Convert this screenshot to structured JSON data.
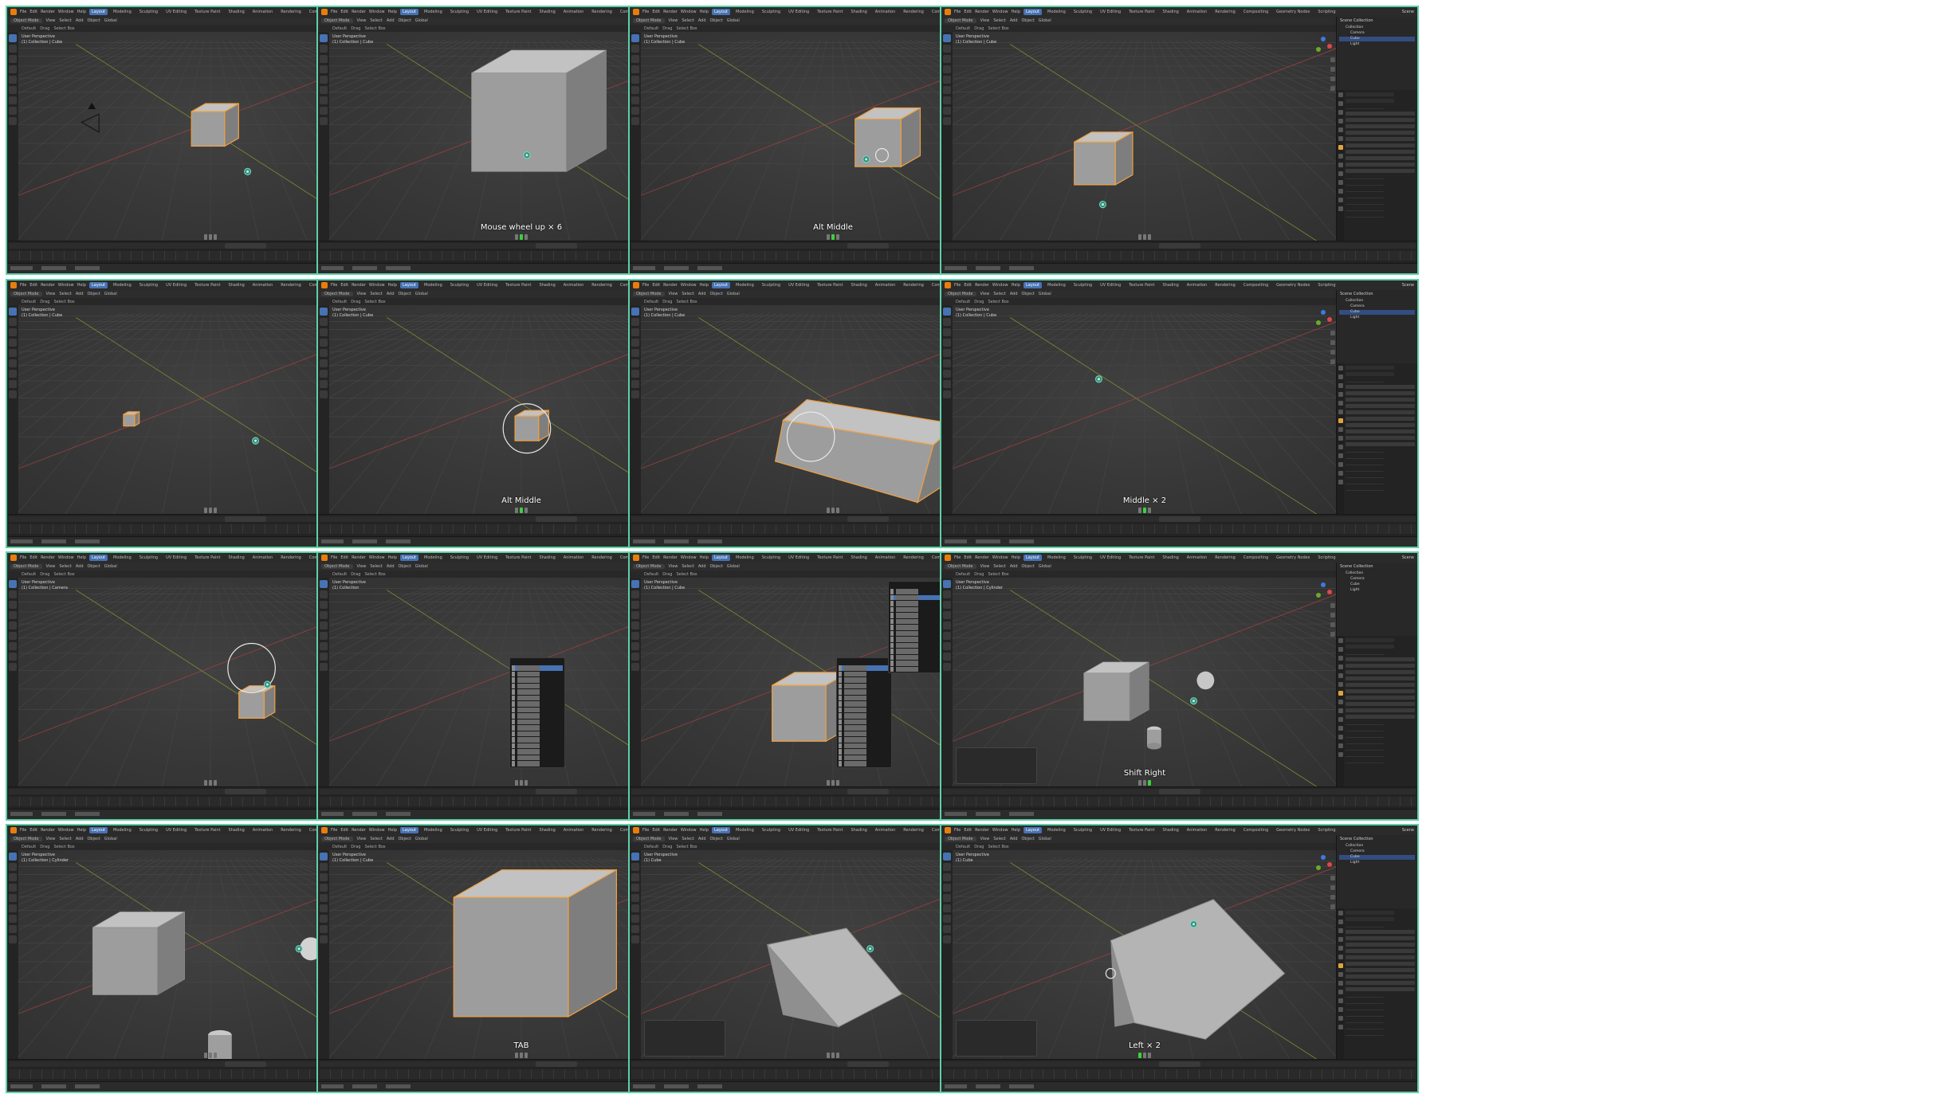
{
  "app": {
    "title": "Blender",
    "menu": [
      "File",
      "Edit",
      "Render",
      "Window",
      "Help"
    ],
    "workspaces": [
      "Layout",
      "Modeling",
      "Sculpting",
      "UV Editing",
      "Texture Paint",
      "Shading",
      "Animation",
      "Rendering",
      "Compositing",
      "Geometry Nodes",
      "Scripting"
    ],
    "active_workspace": "Layout",
    "scene": "Scene",
    "view_layer": "ViewLayer"
  },
  "viewport_header": {
    "mode": "Object Mode",
    "menus": [
      "View",
      "Select",
      "Add",
      "Object"
    ],
    "transform": "Global",
    "orientation": "Default",
    "drag": "Drag",
    "select_box": "Select Box",
    "options": "Options"
  },
  "outliner": {
    "title": "Scene Collection",
    "collection": "Collection",
    "items": [
      "Camera",
      "Cube",
      "Light"
    ]
  },
  "properties": {
    "object_name": "Cube",
    "sections": [
      "Transform",
      "Delta Transform",
      "Relations",
      "Collections",
      "Instancing",
      "Motion Paths",
      "Visibility",
      "Viewport Display"
    ],
    "fields": [
      "Location X",
      "Y",
      "Z",
      "Rotation X",
      "Y",
      "Z",
      "Mode",
      "Scale X",
      "Y",
      "Z"
    ],
    "rotation_mode": "XYZ Euler"
  },
  "timeline": {
    "menus": [
      "Playback",
      "Keying",
      "View",
      "Marker"
    ],
    "start": "Start",
    "end": "End",
    "current_frame": "1",
    "start_frame": "1",
    "end_frame": "250"
  },
  "frames": [
    {
      "view_label": "User Perspective",
      "context": "(1) Collection | Cube",
      "key_overlay": "",
      "scene": "cube_far",
      "mouse": "none",
      "selected": "Cube"
    },
    {
      "view_label": "User Perspective",
      "context": "(1) Collection | Cube",
      "key_overlay": "Mouse wheel up × 6",
      "scene": "cube_big",
      "mouse": "wheel",
      "selected": "Cube"
    },
    {
      "view_label": "User Perspective",
      "context": "(1) Collection | Cube",
      "key_overlay": "Alt Middle",
      "scene": "cube_orbit",
      "mouse": "middle",
      "selected": "Cube"
    },
    {
      "view_label": "User Perspective",
      "context": "(1) Collection | Cube",
      "key_overlay": "",
      "scene": "cube_mid",
      "mouse": "none",
      "selected": "Cube"
    },
    {
      "view_label": "User Perspective",
      "context": "(1) Collection | Cube",
      "key_overlay": "",
      "scene": "cube_tiny",
      "mouse": "none",
      "selected": "Cube"
    },
    {
      "view_label": "User Perspective",
      "context": "(1) Collection | Cube",
      "key_overlay": "Alt Middle",
      "scene": "cube_orbit_ring",
      "mouse": "middle",
      "selected": "Cube"
    },
    {
      "view_label": "User Perspective",
      "context": "(1) Collection | Cube",
      "key_overlay": "",
      "scene": "cube_long",
      "mouse": "none",
      "selected": "Cube"
    },
    {
      "view_label": "User Perspective",
      "context": "(1) Collection | Cube",
      "key_overlay": "Middle × 2",
      "scene": "empty",
      "mouse": "middle",
      "selected": "Cube"
    },
    {
      "view_label": "User Perspective",
      "context": "(1) Collection | Camera",
      "key_overlay": "",
      "scene": "cube_ring",
      "mouse": "none",
      "selected": "Camera"
    },
    {
      "view_label": "User Perspective",
      "context": "(1) Collection",
      "key_overlay": "",
      "scene": "add_menu",
      "mouse": "none",
      "selected": "Collection"
    },
    {
      "view_label": "User Perspective",
      "context": "(1) Collection | Cube",
      "key_overlay": "",
      "scene": "add_submenu",
      "mouse": "none",
      "selected": "Cube"
    },
    {
      "view_label": "User Perspective",
      "context": "(1) Collection | Cylinder",
      "key_overlay": "Shift Right",
      "scene": "three_objects",
      "mouse": "right",
      "selected": "Cylinder"
    },
    {
      "view_label": "User Perspective",
      "context": "(1) Collection | Cylinder",
      "key_overlay": "",
      "scene": "three_objects_panel",
      "mouse": "none",
      "selected": "Cylinder"
    },
    {
      "view_label": "User Perspective",
      "context": "(1) Collection | Cube",
      "key_overlay": "TAB",
      "scene": "cube_edit",
      "mouse": "none",
      "selected": "Cube"
    },
    {
      "view_label": "User Perspective",
      "context": "(1) Cube",
      "key_overlay": "",
      "scene": "wedge",
      "mouse": "none",
      "selected": "Cube"
    },
    {
      "view_label": "User Perspective",
      "context": "(1) Cube",
      "key_overlay": "Left × 2",
      "scene": "cube_cut",
      "mouse": "left",
      "selected": "Cube"
    }
  ]
}
